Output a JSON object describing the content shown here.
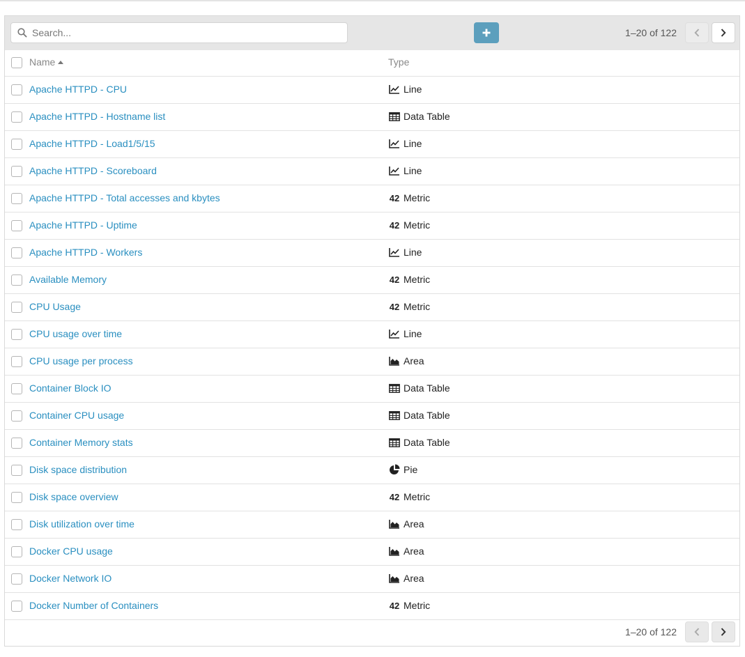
{
  "search": {
    "placeholder": "Search..."
  },
  "pagination": {
    "label": "1–20 of 122"
  },
  "table": {
    "columns": {
      "name": "Name",
      "type": "Type"
    },
    "rows": [
      {
        "name": "Apache HTTPD - CPU",
        "type": "Line",
        "icon": "line-chart-icon"
      },
      {
        "name": "Apache HTTPD - Hostname list",
        "type": "Data Table",
        "icon": "table-icon"
      },
      {
        "name": "Apache HTTPD - Load1/5/15",
        "type": "Line",
        "icon": "line-chart-icon"
      },
      {
        "name": "Apache HTTPD - Scoreboard",
        "type": "Line",
        "icon": "line-chart-icon"
      },
      {
        "name": "Apache HTTPD - Total accesses and kbytes",
        "type": "Metric",
        "icon": "metric-icon"
      },
      {
        "name": "Apache HTTPD - Uptime",
        "type": "Metric",
        "icon": "metric-icon"
      },
      {
        "name": "Apache HTTPD - Workers",
        "type": "Line",
        "icon": "line-chart-icon"
      },
      {
        "name": "Available Memory",
        "type": "Metric",
        "icon": "metric-icon"
      },
      {
        "name": "CPU Usage",
        "type": "Metric",
        "icon": "metric-icon"
      },
      {
        "name": "CPU usage over time",
        "type": "Line",
        "icon": "line-chart-icon"
      },
      {
        "name": "CPU usage per process",
        "type": "Area",
        "icon": "area-chart-icon"
      },
      {
        "name": "Container Block IO",
        "type": "Data Table",
        "icon": "table-icon"
      },
      {
        "name": "Container CPU usage",
        "type": "Data Table",
        "icon": "table-icon"
      },
      {
        "name": "Container Memory stats",
        "type": "Data Table",
        "icon": "table-icon"
      },
      {
        "name": "Disk space distribution",
        "type": "Pie",
        "icon": "pie-chart-icon"
      },
      {
        "name": "Disk space overview",
        "type": "Metric",
        "icon": "metric-icon"
      },
      {
        "name": "Disk utilization over time",
        "type": "Area",
        "icon": "area-chart-icon"
      },
      {
        "name": "Docker CPU usage",
        "type": "Area",
        "icon": "area-chart-icon"
      },
      {
        "name": "Docker Network IO",
        "type": "Area",
        "icon": "area-chart-icon"
      },
      {
        "name": "Docker Number of Containers",
        "type": "Metric",
        "icon": "metric-icon"
      }
    ]
  },
  "icons": {
    "metric_glyph": "42"
  },
  "colors": {
    "link": "#2a8fc0",
    "accent_button": "#5c9fbd",
    "toolbar_bg": "#e6e6e6"
  }
}
